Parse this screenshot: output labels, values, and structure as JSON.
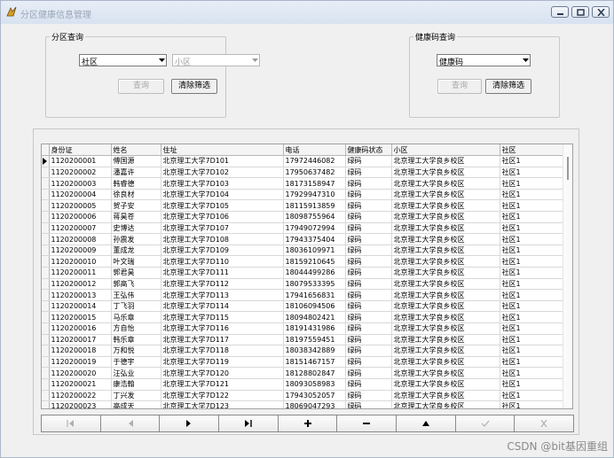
{
  "window": {
    "title": "分区健康信息管理"
  },
  "partition_group": {
    "legend": "分区查询",
    "community_combo": "社区",
    "subarea_combo": "小区",
    "query_label": "查询",
    "clear_label": "清除筛选"
  },
  "health_group": {
    "legend": "健康码查询",
    "code_combo": "健康码",
    "query_label": "查询",
    "clear_label": "清除筛选"
  },
  "table": {
    "columns": [
      "身份证",
      "姓名",
      "住址",
      "电话",
      "健康码状态",
      "小区",
      "社区"
    ],
    "rows": [
      [
        "1120200001",
        "傅国源",
        "北京理工大学7D101",
        "17972446082",
        "绿码",
        "北京理工大学良乡校区",
        "社区1"
      ],
      [
        "1120200002",
        "潘嘉许",
        "北京理工大学7D102",
        "17950637482",
        "绿码",
        "北京理工大学良乡校区",
        "社区1"
      ],
      [
        "1120200003",
        "韩睿德",
        "北京理工大学7D103",
        "18173158947",
        "绿码",
        "北京理工大学良乡校区",
        "社区1"
      ],
      [
        "1120200004",
        "徐良材",
        "北京理工大学7D104",
        "17929947310",
        "绿码",
        "北京理工大学良乡校区",
        "社区1"
      ],
      [
        "1120200005",
        "贺子安",
        "北京理工大学7D105",
        "18115913859",
        "绿码",
        "北京理工大学良乡校区",
        "社区1"
      ],
      [
        "1120200006",
        "蒋昊苍",
        "北京理工大学7D106",
        "18098755964",
        "绿码",
        "北京理工大学良乡校区",
        "社区1"
      ],
      [
        "1120200007",
        "史博达",
        "北京理工大学7D107",
        "17949072994",
        "绿码",
        "北京理工大学良乡校区",
        "社区1"
      ],
      [
        "1120200008",
        "孙震发",
        "北京理工大学7D108",
        "17943375404",
        "绿码",
        "北京理工大学良乡校区",
        "社区1"
      ],
      [
        "1120200009",
        "董成龙",
        "北京理工大学7D109",
        "18036109971",
        "绿码",
        "北京理工大学良乡校区",
        "社区1"
      ],
      [
        "1120200010",
        "叶文瑞",
        "北京理工大学7D110",
        "18159210645",
        "绿码",
        "北京理工大学良乡校区",
        "社区1"
      ],
      [
        "1120200011",
        "郭君昊",
        "北京理工大学7D111",
        "18044499286",
        "绿码",
        "北京理工大学良乡校区",
        "社区1"
      ],
      [
        "1120200012",
        "郭高飞",
        "北京理工大学7D112",
        "18079533395",
        "绿码",
        "北京理工大学良乡校区",
        "社区1"
      ],
      [
        "1120200013",
        "王弘伟",
        "北京理工大学7D113",
        "17941656831",
        "绿码",
        "北京理工大学良乡校区",
        "社区1"
      ],
      [
        "1120200014",
        "丁飞羽",
        "北京理工大学7D114",
        "18106094506",
        "绿码",
        "北京理工大学良乡校区",
        "社区1"
      ],
      [
        "1120200015",
        "马乐章",
        "北京理工大学7D115",
        "18094802421",
        "绿码",
        "北京理工大学良乡校区",
        "社区1"
      ],
      [
        "1120200016",
        "方自怡",
        "北京理工大学7D116",
        "18191431986",
        "绿码",
        "北京理工大学良乡校区",
        "社区1"
      ],
      [
        "1120200017",
        "韩乐章",
        "北京理工大学7D117",
        "18197559451",
        "绿码",
        "北京理工大学良乡校区",
        "社区1"
      ],
      [
        "1120200018",
        "万和悦",
        "北京理工大学7D118",
        "18038342889",
        "绿码",
        "北京理工大学良乡校区",
        "社区1"
      ],
      [
        "1120200019",
        "于德宇",
        "北京理工大学7D119",
        "18151467157",
        "绿码",
        "北京理工大学良乡校区",
        "社区1"
      ],
      [
        "1120200020",
        "汪弘业",
        "北京理工大学7D120",
        "18128802847",
        "绿码",
        "北京理工大学良乡校区",
        "社区1"
      ],
      [
        "1120200021",
        "康浩翰",
        "北京理工大学7D121",
        "18093058983",
        "绿码",
        "北京理工大学良乡校区",
        "社区1"
      ],
      [
        "1120200022",
        "丁兴发",
        "北京理工大学7D122",
        "17943052057",
        "绿码",
        "北京理工大学良乡校区",
        "社区1"
      ],
      [
        "1120200023",
        "高成天",
        "北京理工大学7D123",
        "18069047293",
        "绿码",
        "北京理工大学良乡校区",
        "社区1"
      ]
    ]
  },
  "navigator": {
    "buttons": [
      "first",
      "prior",
      "next",
      "last",
      "insert",
      "delete",
      "edit",
      "post",
      "cancel"
    ]
  },
  "watermark": "CSDN @bit基因重组"
}
